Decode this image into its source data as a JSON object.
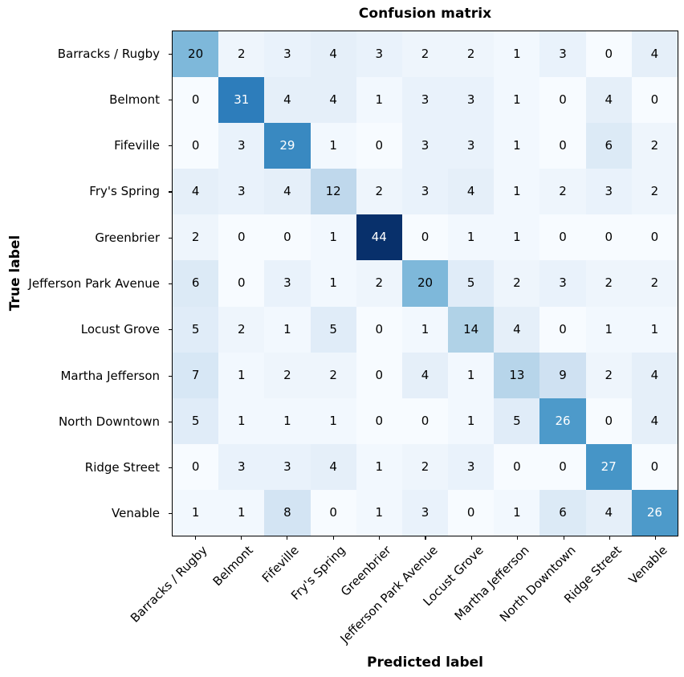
{
  "chart_data": {
    "type": "heatmap",
    "title": "Confusion matrix",
    "xlabel": "Predicted label",
    "ylabel": "True label",
    "colormap": "Blues",
    "grid": false,
    "legend": "none",
    "vmin": 0,
    "vmax": 44,
    "categories": [
      "Barracks / Rugby",
      "Belmont",
      "Fifeville",
      "Fry's Spring",
      "Greenbrier",
      "Jefferson Park Avenue",
      "Locust Grove",
      "Martha Jefferson",
      "North Downtown",
      "Ridge Street",
      "Venable"
    ],
    "x_tick_labels": [
      "Barracks / Rugby",
      "Belmont",
      "Fifeville",
      "Fry's Spring",
      "Greenbrier",
      "Jefferson Park Avenue",
      "Locust Grove",
      "Martha Jefferson",
      "North Downtown",
      "Ridge Street",
      "Venable"
    ],
    "y_tick_labels": [
      "Barracks / Rugby",
      "Belmont",
      "Fifeville",
      "Fry's Spring",
      "Greenbrier",
      "Jefferson Park Avenue",
      "Locust Grove",
      "Martha Jefferson",
      "North Downtown",
      "Ridge Street",
      "Venable"
    ],
    "x_tick_rotation": -45,
    "values": [
      [
        20,
        2,
        3,
        4,
        3,
        2,
        2,
        1,
        3,
        0,
        4
      ],
      [
        0,
        31,
        4,
        4,
        1,
        3,
        3,
        1,
        0,
        4,
        0
      ],
      [
        0,
        3,
        29,
        1,
        0,
        3,
        3,
        1,
        0,
        6,
        2
      ],
      [
        4,
        3,
        4,
        12,
        2,
        3,
        4,
        1,
        2,
        3,
        2
      ],
      [
        2,
        0,
        0,
        1,
        44,
        0,
        1,
        1,
        0,
        0,
        0
      ],
      [
        6,
        0,
        3,
        1,
        2,
        20,
        5,
        2,
        3,
        2,
        2
      ],
      [
        5,
        2,
        1,
        5,
        0,
        1,
        14,
        4,
        0,
        1,
        1
      ],
      [
        7,
        1,
        2,
        2,
        0,
        4,
        1,
        13,
        9,
        2,
        4
      ],
      [
        5,
        1,
        1,
        1,
        0,
        0,
        1,
        5,
        26,
        0,
        4
      ],
      [
        0,
        3,
        3,
        4,
        1,
        2,
        3,
        0,
        0,
        27,
        0
      ],
      [
        1,
        1,
        8,
        0,
        1,
        3,
        0,
        1,
        6,
        4,
        26
      ]
    ],
    "colors": {
      "cmap_stops": [
        "#f7fbff",
        "#deebf7",
        "#c6dbef",
        "#9ecae1",
        "#6baed6",
        "#4292c6",
        "#2171b5",
        "#08519c",
        "#08306b"
      ],
      "text_dark": "#000000",
      "text_light": "#ffffff",
      "axis": "#000000",
      "background": "#ffffff"
    },
    "text_color_threshold": 22
  }
}
